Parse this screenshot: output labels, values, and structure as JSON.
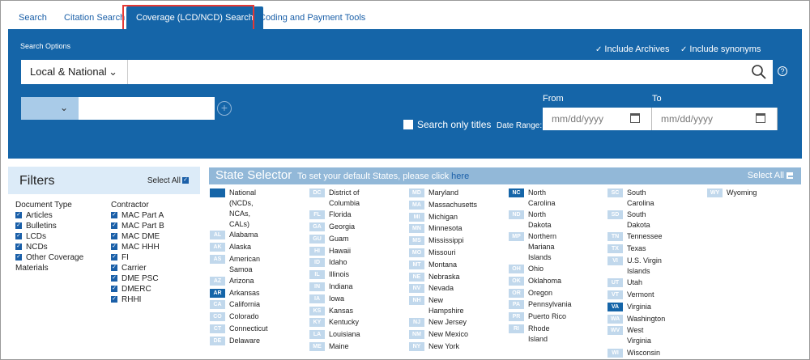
{
  "tabs": [
    {
      "label": "Search",
      "active": false
    },
    {
      "label": "Citation Search",
      "active": false
    },
    {
      "label": "Coverage (LCD/NCD) Search",
      "active": true
    },
    {
      "label": "Coding and Payment Tools",
      "active": false
    }
  ],
  "search": {
    "options_label": "Search Options",
    "include_archives": "Include Archives",
    "include_synonyms": "Include synonyms",
    "scope_value": "Local & National",
    "query_value": "",
    "search_only_titles": "Search only titles",
    "date_range_label": "Date Range:",
    "from_label": "From",
    "to_label": "To",
    "from_placeholder": "mm/dd/yyyy",
    "to_placeholder": "mm/dd/yyyy",
    "help_symbol": "?"
  },
  "filters": {
    "title": "Filters",
    "select_all": "Select All",
    "document_type_label": "Document Type",
    "document_types": [
      "Articles",
      "Bulletins",
      "LCDs",
      "NCDs",
      "Other Coverage"
    ],
    "document_type_tail": "Materials",
    "contractor_label": "Contractor",
    "contractors": [
      "MAC Part A",
      "MAC Part B",
      "MAC DME",
      "MAC HHH",
      "FI",
      "Carrier",
      "DME PSC",
      "DMERC",
      "RHHI"
    ]
  },
  "state_selector": {
    "title": "State Selector",
    "subtitle": "To set your default States, please click",
    "link": "here",
    "select_all": "Select All",
    "columns": [
      [
        {
          "abbr": "",
          "lines": [
            "National",
            "(NCDs,",
            "NCAs,",
            "CALs)"
          ],
          "selected": true
        },
        {
          "abbr": "AL",
          "lines": [
            "Alabama"
          ]
        },
        {
          "abbr": "AK",
          "lines": [
            "Alaska"
          ]
        },
        {
          "abbr": "AS",
          "lines": [
            "American",
            "Samoa"
          ]
        },
        {
          "abbr": "AZ",
          "lines": [
            "Arizona"
          ]
        },
        {
          "abbr": "AR",
          "lines": [
            "Arkansas"
          ],
          "selected": true
        },
        {
          "abbr": "CA",
          "lines": [
            "California"
          ]
        },
        {
          "abbr": "CO",
          "lines": [
            "Colorado"
          ]
        },
        {
          "abbr": "CT",
          "lines": [
            "Connecticut"
          ]
        },
        {
          "abbr": "DE",
          "lines": [
            "Delaware"
          ]
        }
      ],
      [
        {
          "abbr": "DC",
          "lines": [
            "District of",
            "Columbia"
          ]
        },
        {
          "abbr": "FL",
          "lines": [
            "Florida"
          ]
        },
        {
          "abbr": "GA",
          "lines": [
            "Georgia"
          ]
        },
        {
          "abbr": "GU",
          "lines": [
            "Guam"
          ]
        },
        {
          "abbr": "HI",
          "lines": [
            "Hawaii"
          ]
        },
        {
          "abbr": "ID",
          "lines": [
            "Idaho"
          ]
        },
        {
          "abbr": "IL",
          "lines": [
            "Illinois"
          ]
        },
        {
          "abbr": "IN",
          "lines": [
            "Indiana"
          ]
        },
        {
          "abbr": "IA",
          "lines": [
            "Iowa"
          ]
        },
        {
          "abbr": "KS",
          "lines": [
            "Kansas"
          ]
        },
        {
          "abbr": "KY",
          "lines": [
            "Kentucky"
          ]
        },
        {
          "abbr": "LA",
          "lines": [
            "Louisiana"
          ]
        },
        {
          "abbr": "ME",
          "lines": [
            "Maine"
          ]
        }
      ],
      [
        {
          "abbr": "MD",
          "lines": [
            "Maryland"
          ]
        },
        {
          "abbr": "MA",
          "lines": [
            "Massachusetts"
          ]
        },
        {
          "abbr": "MI",
          "lines": [
            "Michigan"
          ]
        },
        {
          "abbr": "MN",
          "lines": [
            "Minnesota"
          ]
        },
        {
          "abbr": "MS",
          "lines": [
            "Mississippi"
          ]
        },
        {
          "abbr": "MO",
          "lines": [
            "Missouri"
          ]
        },
        {
          "abbr": "MT",
          "lines": [
            "Montana"
          ]
        },
        {
          "abbr": "NE",
          "lines": [
            "Nebraska"
          ]
        },
        {
          "abbr": "NV",
          "lines": [
            "Nevada"
          ]
        },
        {
          "abbr": "NH",
          "lines": [
            "New",
            "Hampshire"
          ]
        },
        {
          "abbr": "NJ",
          "lines": [
            "New Jersey"
          ]
        },
        {
          "abbr": "NM",
          "lines": [
            "New Mexico"
          ]
        },
        {
          "abbr": "NY",
          "lines": [
            "New York"
          ]
        }
      ],
      [
        {
          "abbr": "NC",
          "lines": [
            "North",
            "Carolina"
          ],
          "selected": true
        },
        {
          "abbr": "ND",
          "lines": [
            "North",
            "Dakota"
          ]
        },
        {
          "abbr": "MP",
          "lines": [
            "Northern",
            "Mariana",
            "Islands"
          ]
        },
        {
          "abbr": "OH",
          "lines": [
            "Ohio"
          ]
        },
        {
          "abbr": "OK",
          "lines": [
            "Oklahoma"
          ]
        },
        {
          "abbr": "OR",
          "lines": [
            "Oregon"
          ]
        },
        {
          "abbr": "PA",
          "lines": [
            "Pennsylvania"
          ]
        },
        {
          "abbr": "PR",
          "lines": [
            "Puerto Rico"
          ]
        },
        {
          "abbr": "RI",
          "lines": [
            "Rhode",
            "Island"
          ]
        }
      ],
      [
        {
          "abbr": "SC",
          "lines": [
            "South",
            "Carolina"
          ]
        },
        {
          "abbr": "SD",
          "lines": [
            "South",
            "Dakota"
          ]
        },
        {
          "abbr": "TN",
          "lines": [
            "Tennessee"
          ]
        },
        {
          "abbr": "TX",
          "lines": [
            "Texas"
          ]
        },
        {
          "abbr": "VI",
          "lines": [
            "U.S. Virgin",
            "Islands"
          ]
        },
        {
          "abbr": "UT",
          "lines": [
            "Utah"
          ]
        },
        {
          "abbr": "VT",
          "lines": [
            "Vermont"
          ]
        },
        {
          "abbr": "VA",
          "lines": [
            "Virginia"
          ],
          "selected": true
        },
        {
          "abbr": "WA",
          "lines": [
            "Washington"
          ]
        },
        {
          "abbr": "WV",
          "lines": [
            "West",
            "Virginia"
          ]
        },
        {
          "abbr": "WI",
          "lines": [
            "Wisconsin"
          ]
        }
      ],
      [
        {
          "abbr": "WY",
          "lines": [
            "Wyoming"
          ]
        }
      ]
    ]
  }
}
